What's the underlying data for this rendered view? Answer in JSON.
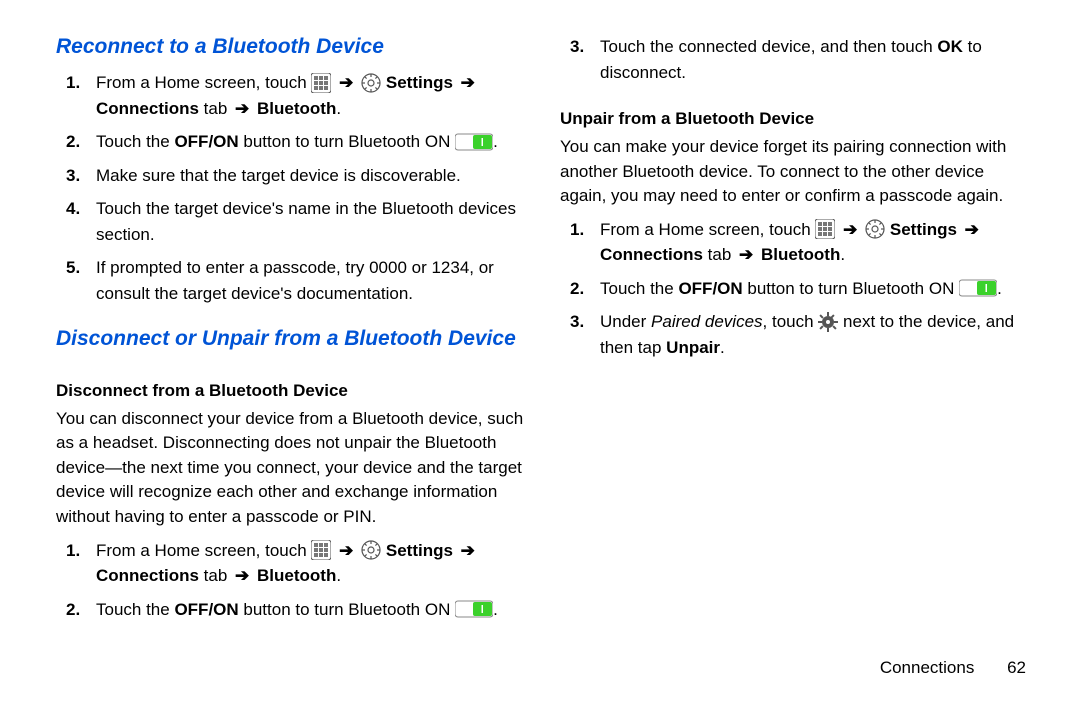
{
  "sectionA": {
    "title": "Reconnect to a Bluetooth Device",
    "step1_a": "From a Home screen, touch ",
    "step1_b": "Settings",
    "step1_c": "Connections",
    "step1_d": " tab ",
    "step1_e": "Bluetooth",
    "step2_a": "Touch the ",
    "step2_b": "OFF/ON",
    "step2_c": " button to turn Bluetooth ON ",
    "step3": "Make sure that the target device is discoverable.",
    "step4": "Touch the target device's name in the Bluetooth devices section.",
    "step5": "If prompted to enter a passcode, try 0000 or 1234, or consult the target device's documentation."
  },
  "sectionB": {
    "title": "Disconnect or Unpair from a Bluetooth Device",
    "subA": "Disconnect from a Bluetooth Device",
    "paraA": "You can disconnect your device from a Bluetooth device, such as a headset. Disconnecting does not unpair the Bluetooth device—the next time you connect, your device and the target device will recognize each other and exchange information without having to enter a passcode or PIN.",
    "d_step1_a": "From a Home screen, touch ",
    "d_step1_b": "Settings",
    "d_step1_c": "Connections",
    "d_step1_d": " tab ",
    "d_step1_e": "Bluetooth",
    "d_step2_a": "Touch the ",
    "d_step2_b": "OFF/ON",
    "d_step2_c": " button to turn Bluetooth ON ",
    "d_step3_a": "Touch the connected device, and then touch ",
    "d_step3_b": "OK",
    "d_step3_c": " to disconnect.",
    "subB": "Unpair from a Bluetooth Device",
    "paraB": "You can make your device forget its pairing connection with another Bluetooth device. To connect to the other device again, you may need to enter or confirm a passcode again.",
    "u_step3_a": "Under ",
    "u_step3_b": "Paired devices",
    "u_step3_c": ", touch ",
    "u_step3_d": " next to the device, and then tap ",
    "u_step3_e": "Unpair",
    "u_step3_f": "."
  },
  "footer": {
    "section": "Connections",
    "page": "62"
  },
  "glyphs": {
    "arrow": "➔",
    "period": "."
  }
}
